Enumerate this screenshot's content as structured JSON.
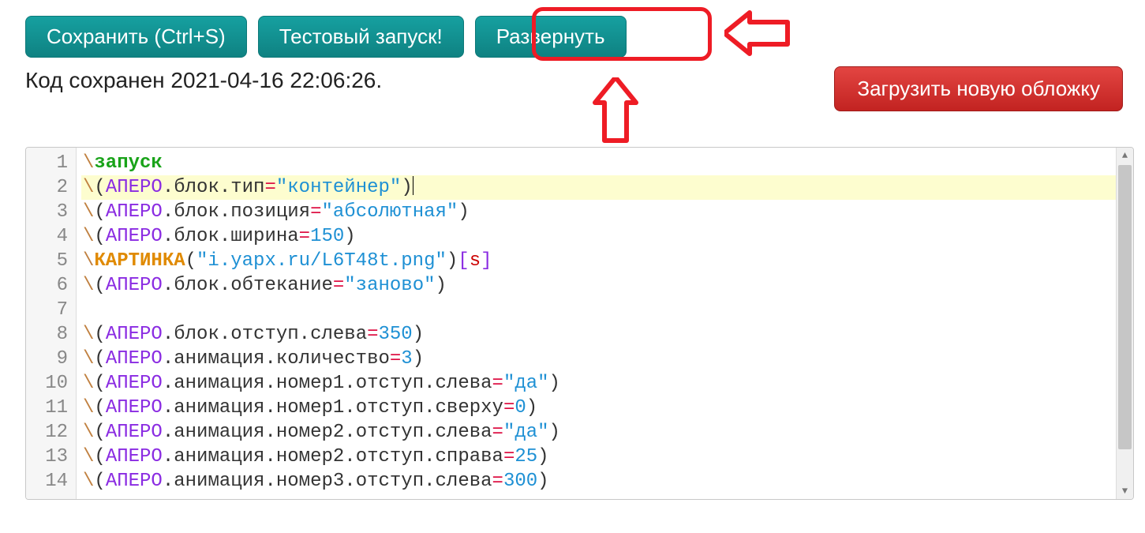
{
  "toolbar": {
    "save": "Сохранить (Ctrl+S)",
    "test": "Тестовый запуск!",
    "deploy": "Развернуть"
  },
  "status": "Код сохранен 2021-04-16 22:06:26.",
  "upload": "Загрузить новую обложку",
  "code": {
    "lines": [
      {
        "n": 1,
        "tokens": [
          [
            "back",
            "\\"
          ],
          [
            "kw",
            "запуск"
          ]
        ]
      },
      {
        "n": 2,
        "hl": true,
        "tokens": [
          [
            "back",
            "\\"
          ],
          [
            "paren",
            "("
          ],
          [
            "var",
            "АПЕРО"
          ],
          [
            "dot",
            "."
          ],
          [
            "prop",
            "блок"
          ],
          [
            "dot",
            "."
          ],
          [
            "prop",
            "тип"
          ],
          [
            "eq",
            "="
          ],
          [
            "str",
            "\"контейнер\""
          ],
          [
            "paren",
            ")"
          ],
          [
            "cursor",
            ""
          ]
        ]
      },
      {
        "n": 3,
        "tokens": [
          [
            "back",
            "\\"
          ],
          [
            "paren",
            "("
          ],
          [
            "var",
            "АПЕРО"
          ],
          [
            "dot",
            "."
          ],
          [
            "prop",
            "блок"
          ],
          [
            "dot",
            "."
          ],
          [
            "prop",
            "позиция"
          ],
          [
            "eq",
            "="
          ],
          [
            "str",
            "\"абсолютная\""
          ],
          [
            "paren",
            ")"
          ]
        ]
      },
      {
        "n": 4,
        "tokens": [
          [
            "back",
            "\\"
          ],
          [
            "paren",
            "("
          ],
          [
            "var",
            "АПЕРО"
          ],
          [
            "dot",
            "."
          ],
          [
            "prop",
            "блок"
          ],
          [
            "dot",
            "."
          ],
          [
            "prop",
            "ширина"
          ],
          [
            "eq",
            "="
          ],
          [
            "num",
            "150"
          ],
          [
            "paren",
            ")"
          ]
        ]
      },
      {
        "n": 5,
        "tokens": [
          [
            "back",
            "\\"
          ],
          [
            "kw2",
            "КАРТИНКА"
          ],
          [
            "paren",
            "("
          ],
          [
            "str",
            "\"i.yapx.ru/L6T48t.png\""
          ],
          [
            "paren",
            ")"
          ],
          [
            "brack",
            "["
          ],
          [
            "s",
            "s"
          ],
          [
            "brack",
            "]"
          ]
        ]
      },
      {
        "n": 6,
        "tokens": [
          [
            "back",
            "\\"
          ],
          [
            "paren",
            "("
          ],
          [
            "var",
            "АПЕРО"
          ],
          [
            "dot",
            "."
          ],
          [
            "prop",
            "блок"
          ],
          [
            "dot",
            "."
          ],
          [
            "prop",
            "обтекание"
          ],
          [
            "eq",
            "="
          ],
          [
            "str",
            "\"заново\""
          ],
          [
            "paren",
            ")"
          ]
        ]
      },
      {
        "n": 7,
        "tokens": []
      },
      {
        "n": 8,
        "tokens": [
          [
            "back",
            "\\"
          ],
          [
            "paren",
            "("
          ],
          [
            "var",
            "АПЕРО"
          ],
          [
            "dot",
            "."
          ],
          [
            "prop",
            "блок"
          ],
          [
            "dot",
            "."
          ],
          [
            "prop",
            "отступ"
          ],
          [
            "dot",
            "."
          ],
          [
            "prop",
            "слева"
          ],
          [
            "eq",
            "="
          ],
          [
            "num",
            "350"
          ],
          [
            "paren",
            ")"
          ]
        ]
      },
      {
        "n": 9,
        "tokens": [
          [
            "back",
            "\\"
          ],
          [
            "paren",
            "("
          ],
          [
            "var",
            "АПЕРО"
          ],
          [
            "dot",
            "."
          ],
          [
            "prop",
            "анимация"
          ],
          [
            "dot",
            "."
          ],
          [
            "prop",
            "количество"
          ],
          [
            "eq",
            "="
          ],
          [
            "num",
            "3"
          ],
          [
            "paren",
            ")"
          ]
        ]
      },
      {
        "n": 10,
        "tokens": [
          [
            "back",
            "\\"
          ],
          [
            "paren",
            "("
          ],
          [
            "var",
            "АПЕРО"
          ],
          [
            "dot",
            "."
          ],
          [
            "prop",
            "анимация"
          ],
          [
            "dot",
            "."
          ],
          [
            "prop",
            "номер1"
          ],
          [
            "dot",
            "."
          ],
          [
            "prop",
            "отступ"
          ],
          [
            "dot",
            "."
          ],
          [
            "prop",
            "слева"
          ],
          [
            "eq",
            "="
          ],
          [
            "str",
            "\"да\""
          ],
          [
            "paren",
            ")"
          ]
        ]
      },
      {
        "n": 11,
        "tokens": [
          [
            "back",
            "\\"
          ],
          [
            "paren",
            "("
          ],
          [
            "var",
            "АПЕРО"
          ],
          [
            "dot",
            "."
          ],
          [
            "prop",
            "анимация"
          ],
          [
            "dot",
            "."
          ],
          [
            "prop",
            "номер1"
          ],
          [
            "dot",
            "."
          ],
          [
            "prop",
            "отступ"
          ],
          [
            "dot",
            "."
          ],
          [
            "prop",
            "сверху"
          ],
          [
            "eq",
            "="
          ],
          [
            "num",
            "0"
          ],
          [
            "paren",
            ")"
          ]
        ]
      },
      {
        "n": 12,
        "tokens": [
          [
            "back",
            "\\"
          ],
          [
            "paren",
            "("
          ],
          [
            "var",
            "АПЕРО"
          ],
          [
            "dot",
            "."
          ],
          [
            "prop",
            "анимация"
          ],
          [
            "dot",
            "."
          ],
          [
            "prop",
            "номер2"
          ],
          [
            "dot",
            "."
          ],
          [
            "prop",
            "отступ"
          ],
          [
            "dot",
            "."
          ],
          [
            "prop",
            "слева"
          ],
          [
            "eq",
            "="
          ],
          [
            "str",
            "\"да\""
          ],
          [
            "paren",
            ")"
          ]
        ]
      },
      {
        "n": 13,
        "tokens": [
          [
            "back",
            "\\"
          ],
          [
            "paren",
            "("
          ],
          [
            "var",
            "АПЕРО"
          ],
          [
            "dot",
            "."
          ],
          [
            "prop",
            "анимация"
          ],
          [
            "dot",
            "."
          ],
          [
            "prop",
            "номер2"
          ],
          [
            "dot",
            "."
          ],
          [
            "prop",
            "отступ"
          ],
          [
            "dot",
            "."
          ],
          [
            "prop",
            "справа"
          ],
          [
            "eq",
            "="
          ],
          [
            "num",
            "25"
          ],
          [
            "paren",
            ")"
          ]
        ]
      },
      {
        "n": 14,
        "tokens": [
          [
            "back",
            "\\"
          ],
          [
            "paren",
            "("
          ],
          [
            "var",
            "АПЕРО"
          ],
          [
            "dot",
            "."
          ],
          [
            "prop",
            "анимация"
          ],
          [
            "dot",
            "."
          ],
          [
            "prop",
            "номер3"
          ],
          [
            "dot",
            "."
          ],
          [
            "prop",
            "отступ"
          ],
          [
            "dot",
            "."
          ],
          [
            "prop",
            "слева"
          ],
          [
            "eq",
            "="
          ],
          [
            "num",
            "300"
          ],
          [
            "paren",
            ")"
          ]
        ]
      }
    ]
  }
}
